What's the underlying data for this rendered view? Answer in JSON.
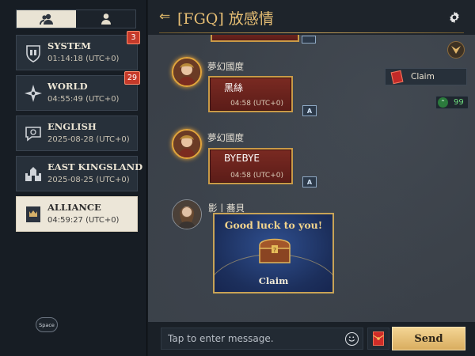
{
  "sidebar": {
    "tabs": [
      {
        "icon": "group-icon"
      },
      {
        "icon": "person-icon"
      }
    ],
    "channels": [
      {
        "name": "SYSTEM",
        "time": "01:14:18 (UTC+0)",
        "badge": "3",
        "icon": "helmet-icon"
      },
      {
        "name": "WORLD",
        "time": "04:55:49 (UTC+0)",
        "badge": "29",
        "icon": "compass-icon"
      },
      {
        "name": "ENGLISH",
        "time": "2025-08-28 (UTC+0)",
        "icon": "chat-bubble-icon"
      },
      {
        "name": "EAST KINGSLAND",
        "time": "2025-08-25 (UTC+0)",
        "icon": "castle-icon"
      },
      {
        "name": "ALLIANCE",
        "time": "04:59:27 (UTC+0)",
        "icon": "alliance-banner-icon",
        "active": true
      }
    ],
    "space_label": "Space"
  },
  "header": {
    "back_icon": "back-arrow-icon",
    "title": "[FGQ] 放感情"
  },
  "messages": [
    {
      "sender": "夢幻國度",
      "text": "黑絲",
      "time": "04:58 (UTC+0)"
    },
    {
      "sender": "夢幻國度",
      "text": "BYEBYE",
      "time": "04:58 (UTC+0)"
    },
    {
      "sender": "影丨蕎貝",
      "gift_title": "Good luck to you!",
      "gift_action": "Claim"
    }
  ],
  "translate_label": "A",
  "side_panel": {
    "claim_label": "Claim",
    "online_count": "99"
  },
  "input_bar": {
    "placeholder": "Tap to enter message.",
    "send_label": "Send"
  },
  "colors": {
    "accent_gold": "#e6be74",
    "bubble_red": "#6a241e",
    "send_gold": "#e6c27a",
    "badge_red": "#c63a2a",
    "online_green": "#6fe07f"
  }
}
